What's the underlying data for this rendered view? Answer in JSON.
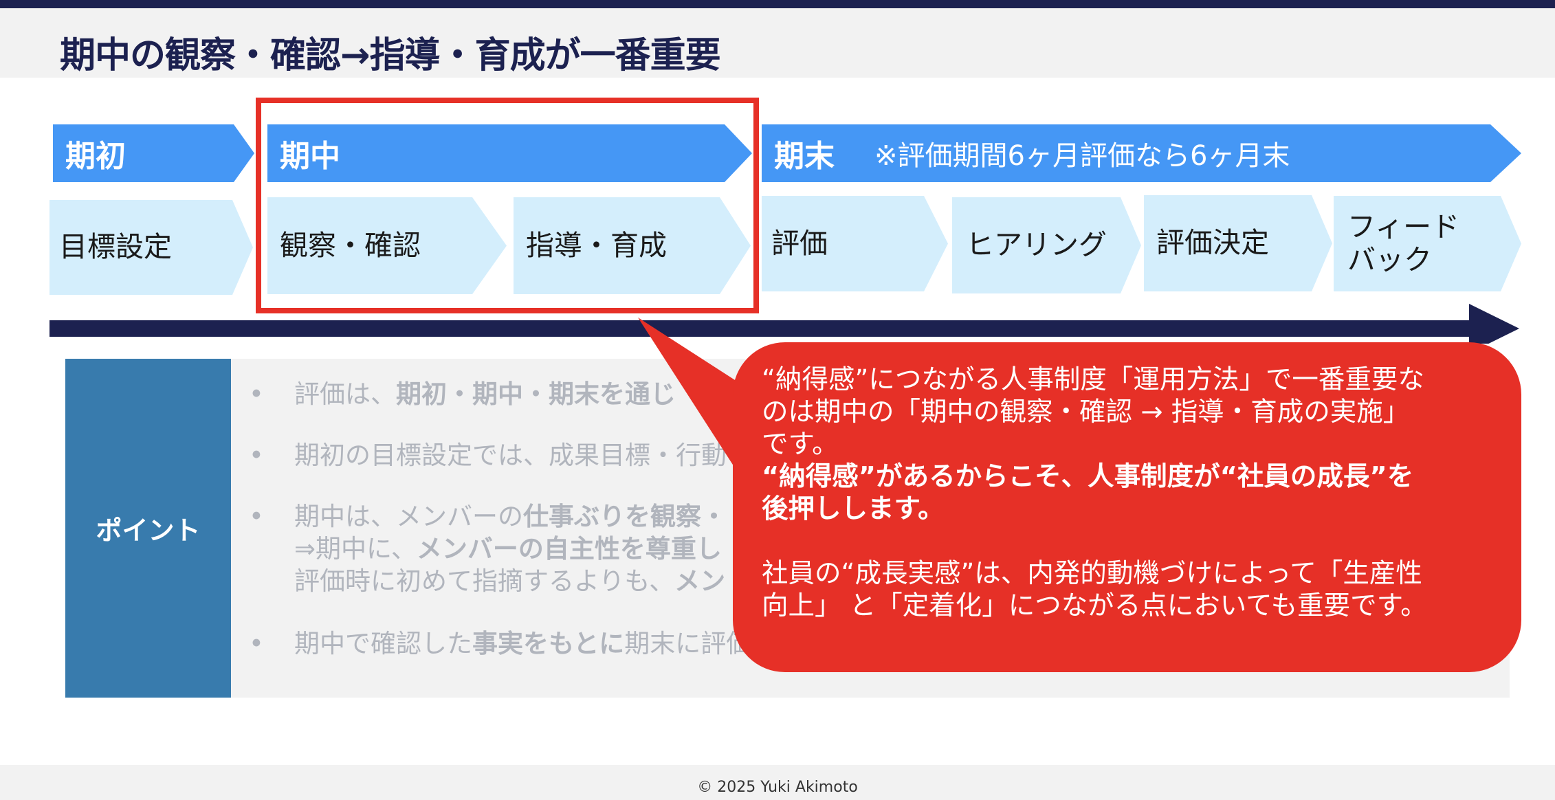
{
  "title": "期中の観察・確認→指導・育成が一番重要",
  "phases": {
    "initial": "期初",
    "mid": "期中",
    "end": "期末",
    "end_note": "※評価期間6ヶ月評価なら6ヶ月末"
  },
  "steps": {
    "goal_setting": "目標設定",
    "observe_confirm": "観察・確認",
    "guide_develop": "指導・育成",
    "evaluation": "評価",
    "hearing": "ヒアリング",
    "decision": "評価決定",
    "feedback_line1": "フィード",
    "feedback_line2": "バック"
  },
  "points": {
    "label": "ポイント",
    "items": [
      {
        "parts": [
          "評価は、",
          "期初・期中・期末を通じ"
        ]
      },
      {
        "parts": [
          "期初の目標設定では、成果目標・行動"
        ]
      },
      {
        "line1": [
          "期中は、メンバーの",
          "仕事ぶりを観察・"
        ],
        "line2": [
          "⇒期中に、",
          "メンバーの自主性を尊重し"
        ],
        "line3": [
          "評価時に初めて指摘するよりも、",
          "メン"
        ]
      },
      {
        "parts": [
          "期中で確認した",
          "事実をもとに",
          "期末に評価"
        ]
      }
    ]
  },
  "callout": {
    "para1_line1": "“納得感”につながる人事制度「運用方法」で一番重要な",
    "para1_line2": "のは期中の「期中の観察・確認 → 指導・育成の実施」",
    "para1_line3": "です。",
    "bold_line1": "“納得感”があるからこそ、人事制度が“社員の成長”を",
    "bold_line2": "後押しします。",
    "para2_line1": "社員の“成長実感”は、内発的動機づけによって「生産性",
    "para2_line2": "向上」 と「定着化」につながる点においても重要です。"
  },
  "footer": {
    "copyright": "© 2025 Yuki Akimoto"
  },
  "colors": {
    "navy": "#1c2150",
    "phase_blue": "#4597f5",
    "step_light_blue": "#d4eefc",
    "highlight_red": "#e63027",
    "point_label_blue": "#387bad",
    "panel_gray": "#f2f2f2"
  }
}
